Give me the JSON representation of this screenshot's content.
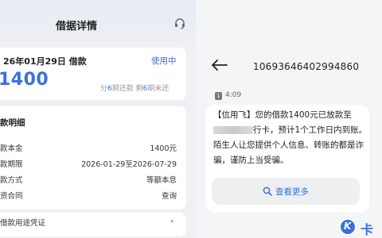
{
  "left": {
    "header_title": "借据详情",
    "loan": {
      "date_label": "26年01月29日 借款",
      "status": "使用中",
      "amount": "1400",
      "installments_prefix": "分",
      "installments_total": "6",
      "installments_mid": "期还款 剩",
      "installments_remaining": "6",
      "installments_suffix": "期未还"
    },
    "detail": {
      "section_title": "款明细",
      "rows": [
        {
          "label": "款本金",
          "value": "1400元"
        },
        {
          "label": "款期限",
          "value": "2026-01-29至2026-07-29"
        },
        {
          "label": "款方式",
          "value": "等额本息"
        },
        {
          "label": "资合同",
          "value": "查询"
        }
      ]
    },
    "voucher_label": "借款用途凭证"
  },
  "right": {
    "sender": "10693646402994860",
    "sim_badge": "1",
    "time": "4:09",
    "message": {
      "part1": "【信用飞】您的借款1400元已放款至",
      "part2": "行卡，预计1个工作日内到账。陌生人让您提供个人信息、转账的都是诈骗，谨防上当受骗。"
    },
    "more_label": "查看更多",
    "watermark_text": "卡"
  }
}
